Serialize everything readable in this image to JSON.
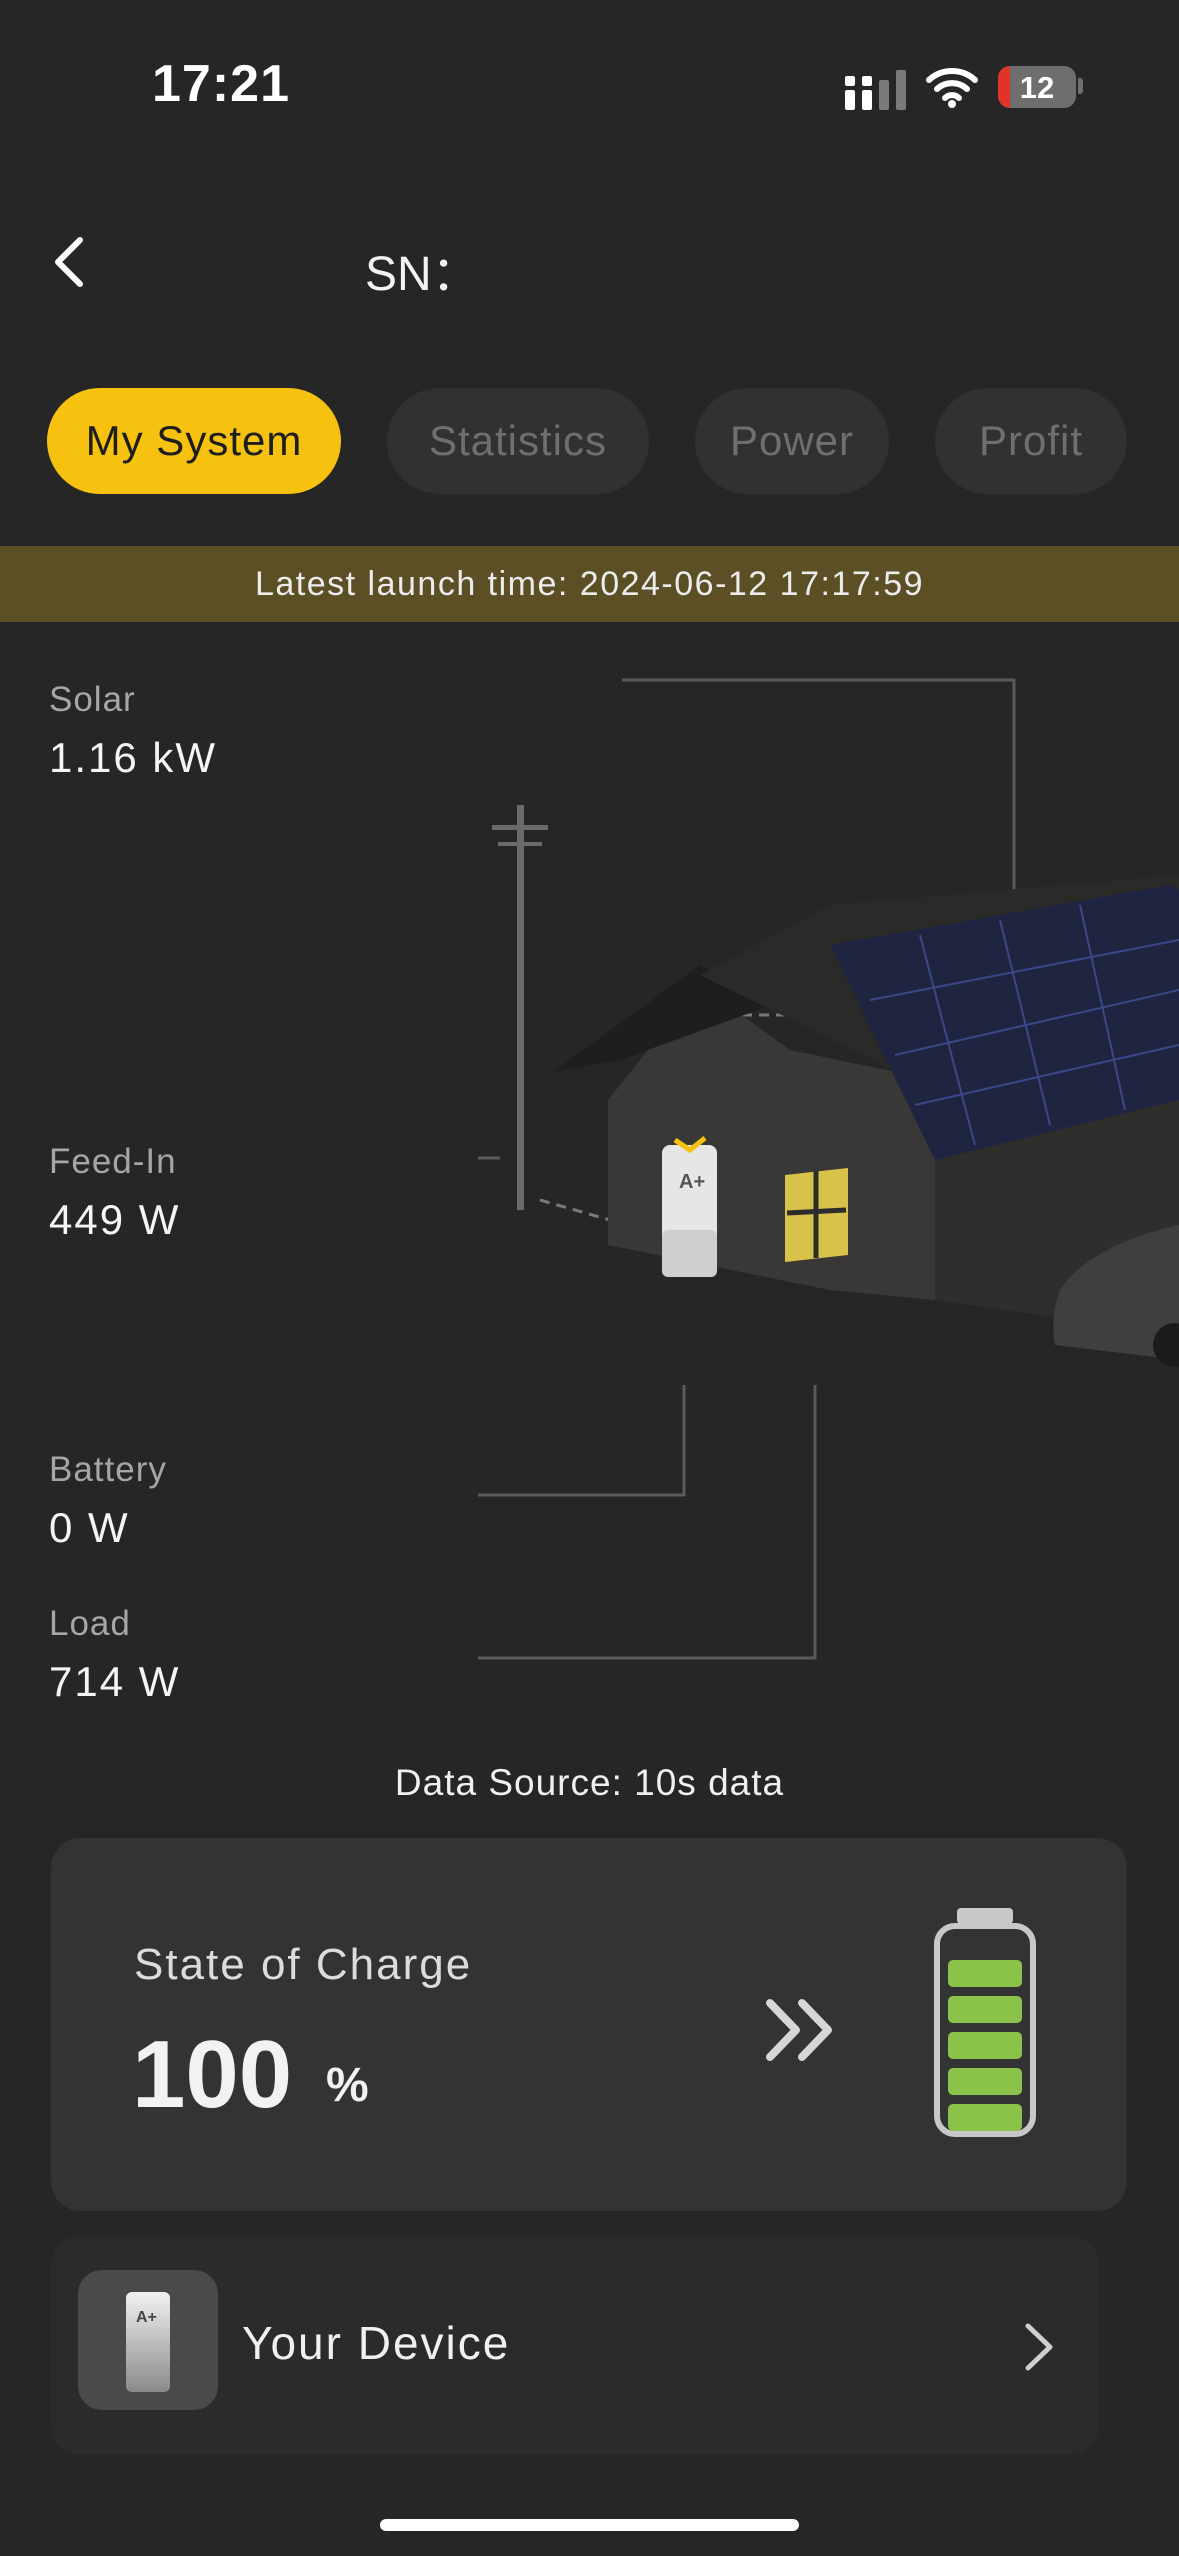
{
  "status_bar": {
    "time": "17:21",
    "battery_level": "12",
    "signal_icon": "signal-icon",
    "wifi_icon": "wifi-icon"
  },
  "header": {
    "title": "SN：",
    "back_icon": "chevron-left-icon"
  },
  "tabs": [
    {
      "label": "My System",
      "active": true
    },
    {
      "label": "Statistics",
      "active": false
    },
    {
      "label": "Power",
      "active": false
    },
    {
      "label": "Profit",
      "active": false
    }
  ],
  "banner": {
    "text": "Latest launch time: 2024-06-12 17:17:59"
  },
  "metrics": {
    "solar": {
      "label": "Solar",
      "value": "1.16 kW"
    },
    "feed_in": {
      "label": "Feed-In",
      "value": "449 W"
    },
    "battery": {
      "label": "Battery",
      "value": "0 W"
    },
    "load": {
      "label": "Load",
      "value": "714 W"
    }
  },
  "data_source": "Data Source: 10s data",
  "soc": {
    "label": "State of Charge",
    "value": "100",
    "unit": "%",
    "charge_fraction": 1.0,
    "icon": "battery-icon"
  },
  "device": {
    "label": "Your Device",
    "icon": "energy-storage-device-icon",
    "chevron_icon": "chevron-right-icon"
  },
  "colors": {
    "accent": "#f7c20f",
    "background": "#262626",
    "battery_green": "#8bc34a",
    "banner": "#5c4e25"
  }
}
